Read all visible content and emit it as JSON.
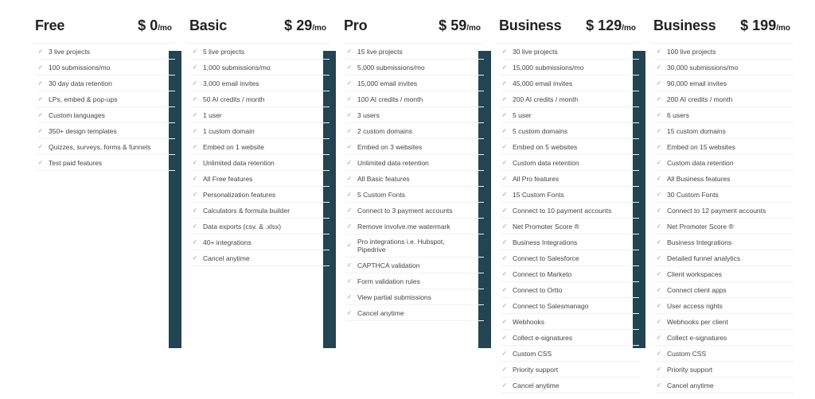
{
  "plans": [
    {
      "name": "Free",
      "price_currency": "$",
      "price_amount": "0",
      "price_period": "/mo",
      "features": [
        "3 live projects",
        "100 submissions/mo",
        "30 day data retention",
        "LPs,  embed & pop-ups",
        "Custom languages",
        "350+ design templates",
        "Quizzes, surveys, forms & funnels",
        "Test paid features"
      ]
    },
    {
      "name": "Basic",
      "price_currency": "$",
      "price_amount": "29",
      "price_period": "/mo",
      "features": [
        "5 live projects",
        "1,000 submissions/mo",
        "3,000 email invites",
        "50 AI credits / month",
        "1 user",
        "1 custom domain",
        "Embed on 1 website",
        "Unlimited data retention",
        "All Free features",
        "Personalization features",
        "Calculators & formula builder",
        "Data exports (csv. & .xlsx)",
        "40+ integrations",
        "Cancel anytime"
      ]
    },
    {
      "name": "Pro",
      "price_currency": "$",
      "price_amount": "59",
      "price_period": "/mo",
      "features": [
        "15 live projects",
        "5,000 submissions/mo",
        "15,000 email invites",
        "100 AI credits / month",
        "3 users",
        "2 custom domains",
        "Embed on 3 websites",
        "Unlimited data retention",
        "All Basic features",
        "5 Custom Fonts",
        "Connect to 3 payment accounts",
        "Remove involve.me watermark",
        "Pro integrations i.e. Hubspot, Pipedrive",
        "CAPTHCA validation",
        "Form validation rules",
        "View partial submissions",
        "Cancel anytime"
      ]
    },
    {
      "name": "Business",
      "price_currency": "$",
      "price_amount": "129",
      "price_period": "/mo",
      "features": [
        "30 live projects",
        "15,000 submissions/mo",
        "45,000 email invites",
        "200 AI credits / month",
        "5 user",
        "5 custom domains",
        "Embed on 5 websites",
        "Custom data retention",
        "All Pro features",
        "15 Custom Fonts",
        "Connect to 10 payment accounts",
        "Net Promoter Score ®",
        "Business Integrations",
        "Connect to Salesforce",
        "Connect to Marketo",
        "Connect to Ortto",
        "Connect to Salesmanago",
        "Webhooks",
        "Collect e-signatures",
        "Custom CSS",
        "Priority support",
        "Cancel anytime"
      ]
    },
    {
      "name": "Business",
      "price_currency": "$",
      "price_amount": "199",
      "price_period": "/mo",
      "features": [
        "100 live projects",
        "30,000 submissions/mo",
        "90,000 email invites",
        "200 AI credits / month",
        "6 users",
        "15 custom domains",
        "Embed on 15 websites",
        "Custom data retention",
        "All Business features",
        "30 Custom Fonts",
        "Connect to 12 payment accounts",
        "Net Promoter Score ®",
        "Business Integrations",
        "Detailed funnel analytics",
        "Client workspaces",
        "Connect client apps",
        "User access rights",
        "Webhooks per client",
        "Collect e-signatures",
        "Custom CSS",
        "Priority support",
        "Cancel anytime"
      ]
    }
  ],
  "icons": {
    "feature_check": "✓"
  },
  "colors": {
    "accent_bar": "#234451",
    "divider": "#f1f1f1",
    "check": "#9a9a9a"
  }
}
